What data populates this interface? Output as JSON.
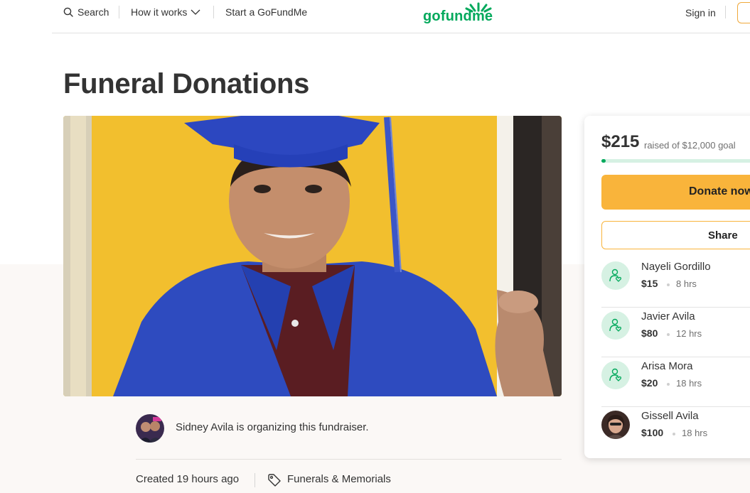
{
  "header": {
    "search_label": "Search",
    "how_it_works_label": "How it works",
    "start_label": "Start a GoFundMe",
    "logo_text": "gofundme",
    "signin_label": "Sign in"
  },
  "campaign": {
    "title": "Funeral Donations",
    "organizer_text": "Sidney Avila is organizing this fundraiser.",
    "created": "Created 19 hours ago",
    "category": "Funerals & Memorials"
  },
  "donation_card": {
    "raised_amount": "$215",
    "raised_text": "raised of $12,000 goal",
    "progress_fraction": 0.018,
    "donate_label": "Donate now",
    "share_label": "Share",
    "donors": [
      {
        "name": "Nayeli Gordillo",
        "amount": "$15",
        "time": "8 hrs"
      },
      {
        "name": "Javier Avila",
        "amount": "$80",
        "time": "12 hrs"
      },
      {
        "name": "Arisa Mora",
        "amount": "$20",
        "time": "18 hrs"
      },
      {
        "name": "Gissell Avila",
        "amount": "$100",
        "time": "18 hrs"
      }
    ]
  },
  "colors": {
    "brand_green": "#02a95c",
    "donate_yellow": "#f9b43b",
    "avatar_mint": "#d6f1e3"
  },
  "icons": [
    "search-icon",
    "chevron-down-icon",
    "gofundme-logo",
    "tag-icon",
    "donor-heart-icon"
  ]
}
